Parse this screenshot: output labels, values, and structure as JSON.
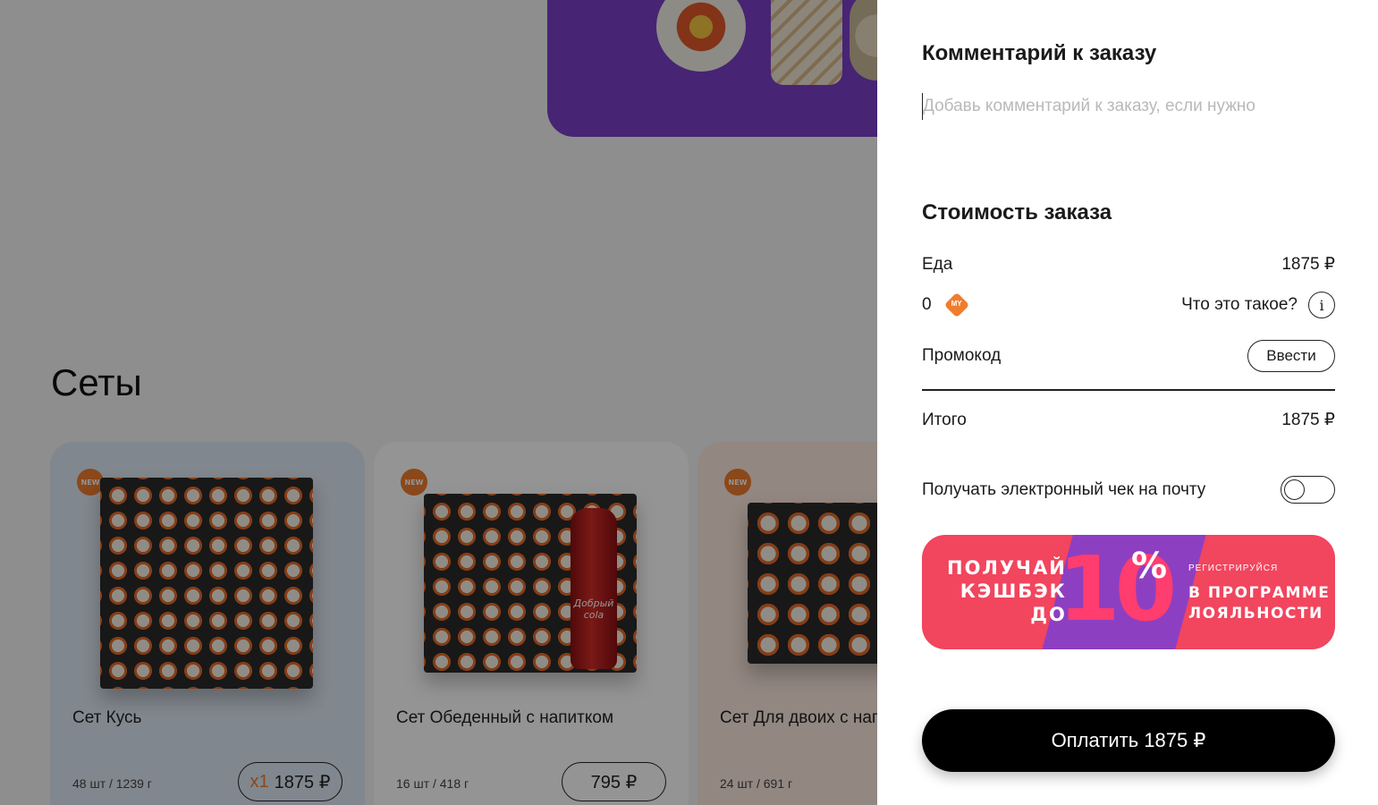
{
  "background": {
    "section_title": "Сеты",
    "cards": [
      {
        "badge": "NEW",
        "name": "Сет Кусь",
        "meta": "48 шт / 1239 г",
        "qty": "x1",
        "price": "1875 ₽"
      },
      {
        "badge": "NEW",
        "name": "Сет Обеденный с напитком",
        "meta": "16 шт / 418 г",
        "price": "795 ₽",
        "bottle_label": "Добрый cola"
      },
      {
        "badge": "NEW",
        "name": "Сет Для двоих с напитком",
        "meta": "24 шт / 691 г"
      }
    ]
  },
  "panel": {
    "comment_title": "Комментарий к заказу",
    "comment_placeholder": "Добавь комментарий к заказу, если нужно",
    "comment_value": "",
    "cost_title": "Стоимость заказа",
    "food_label": "Еда",
    "food_value": "1875 ₽",
    "points_value": "0",
    "coin_label": "MY",
    "points_help": "Что это такое?",
    "promo_label": "Промокод",
    "promo_button": "Ввести",
    "total_label": "Итого",
    "total_value": "1875 ₽",
    "receipt_label": "Получать электронный чек на почту",
    "receipt_toggle_on": false,
    "banner": {
      "left_line1": "ПОЛУЧАЙ",
      "left_line2": "КЭШБЭК",
      "left_line3": "ДО",
      "big_number": "10",
      "percent": "%",
      "small": "РЕГИСТРИРУЙСЯ",
      "right_line1": "В ПРОГРАММЕ",
      "right_line2": "ЛОЯЛЬНОСТИ"
    },
    "pay_button": "Оплатить 1875 ₽"
  },
  "colors": {
    "accent_orange": "#f07d2e",
    "banner_pink": "#f2455e",
    "banner_purple": "#8d3fc2",
    "pay_button_bg": "#000000"
  }
}
